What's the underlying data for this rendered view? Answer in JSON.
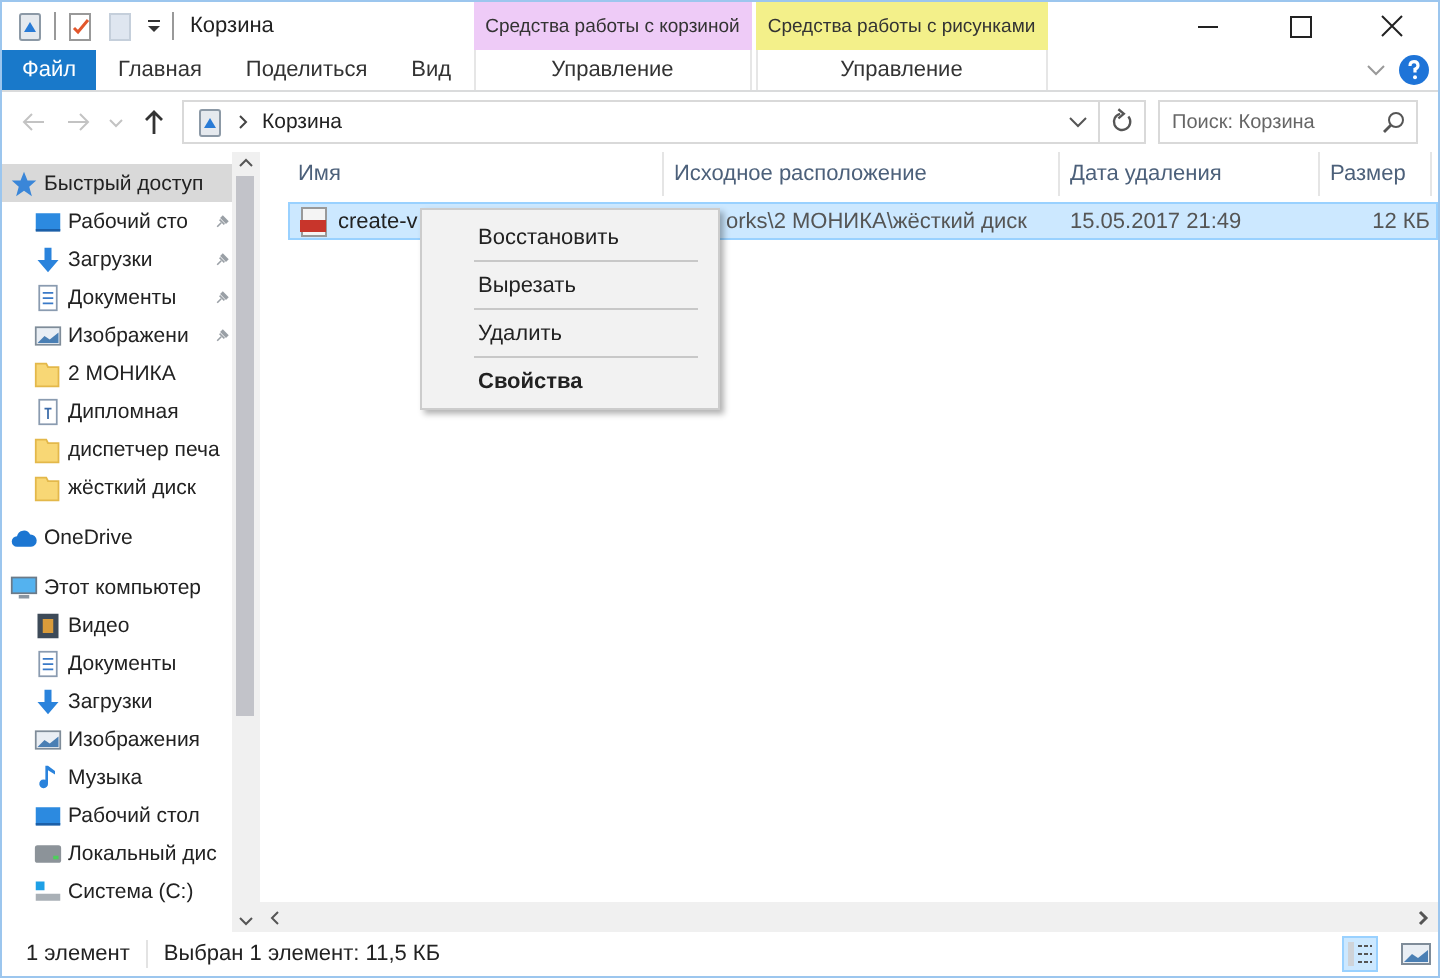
{
  "window": {
    "title": "Корзина"
  },
  "ribbon": {
    "file_tab": "Файл",
    "tabs": [
      {
        "label": "Главная",
        "selected": false
      },
      {
        "label": "Поделиться",
        "selected": false
      },
      {
        "label": "Вид",
        "selected": false
      }
    ],
    "context_groups": [
      {
        "header": "Средства работы с корзиной",
        "color": "#eecbf7",
        "tab": {
          "label": "Управление",
          "selected": false
        }
      },
      {
        "header": "Средства работы с рисунками",
        "color": "#f3f08a",
        "tab": {
          "label": "Управление",
          "selected": false
        }
      }
    ]
  },
  "address": {
    "path": "Корзина"
  },
  "search": {
    "placeholder": "Поиск: Корзина"
  },
  "sidebar": {
    "items": [
      {
        "kind": "star",
        "label": "Быстрый доступ",
        "selected": true,
        "pinned": false,
        "children": [
          {
            "kind": "desktop",
            "label": "Рабочий сто",
            "selected": false,
            "pinned": true
          },
          {
            "kind": "download",
            "label": "Загрузки",
            "selected": false,
            "pinned": true
          },
          {
            "kind": "document",
            "label": "Документы",
            "selected": false,
            "pinned": true
          },
          {
            "kind": "image",
            "label": "Изображени",
            "selected": false,
            "pinned": true
          },
          {
            "kind": "folder",
            "label": "2 МОНИКА",
            "selected": false,
            "pinned": false
          },
          {
            "kind": "textfile",
            "label": "Дипломная",
            "selected": false,
            "pinned": false
          },
          {
            "kind": "folder",
            "label": "диспетчер печа",
            "selected": false,
            "pinned": false
          },
          {
            "kind": "folder",
            "label": "жёсткий диск",
            "selected": false,
            "pinned": false
          }
        ]
      },
      {
        "kind": "cloud",
        "label": "OneDrive",
        "selected": false,
        "pinned": false
      },
      {
        "kind": "computer",
        "label": "Этот компьютер",
        "selected": false,
        "pinned": false,
        "children": [
          {
            "kind": "video",
            "label": "Видео",
            "selected": false,
            "pinned": false
          },
          {
            "kind": "document",
            "label": "Документы",
            "selected": false,
            "pinned": false
          },
          {
            "kind": "download",
            "label": "Загрузки",
            "selected": false,
            "pinned": false
          },
          {
            "kind": "image",
            "label": "Изображения",
            "selected": false,
            "pinned": false
          },
          {
            "kind": "music",
            "label": "Музыка",
            "selected": false,
            "pinned": false
          },
          {
            "kind": "desktop",
            "label": "Рабочий стол",
            "selected": false,
            "pinned": false
          },
          {
            "kind": "drive",
            "label": "Локальный дис",
            "selected": false,
            "pinned": false
          },
          {
            "kind": "system",
            "label": "Система (C:)",
            "selected": false,
            "pinned": false
          }
        ]
      }
    ]
  },
  "table": {
    "columns": [
      "Имя",
      "Исходное расположение",
      "Дата удаления",
      "Размер"
    ],
    "rows": [
      {
        "name": "create-v",
        "location": "orks\\2 МОНИКА\\жёсткий диск",
        "date": "15.05.2017 21:49",
        "size": "12 КБ",
        "selected": true
      }
    ]
  },
  "context_menu": {
    "items": [
      {
        "label": "Восстановить",
        "bold": false
      },
      {
        "label": "Вырезать",
        "bold": false
      },
      {
        "label": "Удалить",
        "bold": false
      },
      {
        "label": "Свойства",
        "bold": true
      }
    ]
  },
  "status_bar": {
    "count": "1 элемент",
    "selection": "Выбран 1 элемент: 11,5 КБ",
    "views": [
      {
        "kind": "details",
        "selected": true
      },
      {
        "kind": "tiles",
        "selected": false
      }
    ]
  }
}
